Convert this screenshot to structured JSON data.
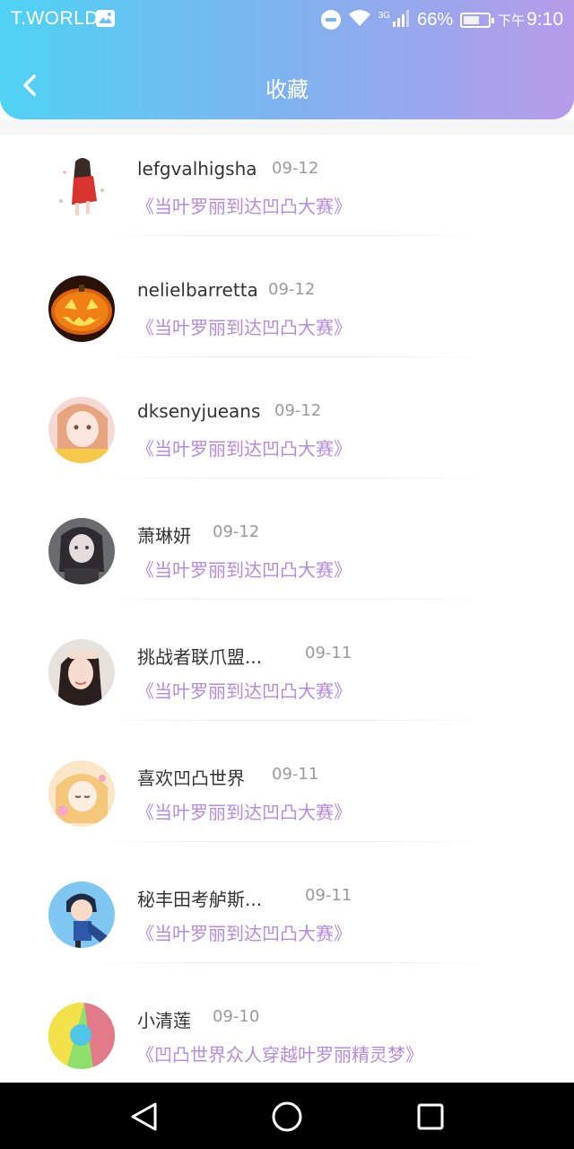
{
  "status_bar": {
    "carrier": "T.WORLD",
    "network": "3G",
    "battery": "66%",
    "battery_level": 0.66,
    "time_prefix": "下午",
    "time": "9:10"
  },
  "header": {
    "title": "收藏",
    "back_icon": "chevron-left-icon"
  },
  "colors": {
    "gradient_start": "#4fd3f5",
    "gradient_end": "#b79be9",
    "work_title": "#b58ae0",
    "username": "#333333",
    "date": "#9a9a9a"
  },
  "favorites": [
    {
      "name": "lefgvalhigsha",
      "date": "09-12",
      "work": "《当叶罗丽到达凹凸大赛》",
      "avatar": "avatar-girl-red-dress"
    },
    {
      "name": "nelielbarretta",
      "date": "09-12",
      "work": "《当叶罗丽到达凹凸大赛》",
      "avatar": "avatar-pumpkin"
    },
    {
      "name": "dksenyjueans",
      "date": "09-12",
      "work": "《当叶罗丽到达凹凸大赛》",
      "avatar": "avatar-anime-girl-pink"
    },
    {
      "name": "萧琳妍",
      "date": "09-12",
      "work": "《当叶罗丽到达凹凸大赛》",
      "avatar": "avatar-dark-girl"
    },
    {
      "name": "挑战者联爪盟...",
      "date": "09-11",
      "work": "《当叶罗丽到达凹凸大赛》",
      "avatar": "avatar-photo-girl"
    },
    {
      "name": "喜欢凹凸世界",
      "date": "09-11",
      "work": "《当叶罗丽到达凹凸大赛》",
      "avatar": "avatar-anime-blonde"
    },
    {
      "name": "秘丰田考舻斯...",
      "date": "09-11",
      "work": "《当叶罗丽到达凹凸大赛》",
      "avatar": "avatar-detective"
    },
    {
      "name": "小清莲",
      "date": "09-10",
      "work": "《凹凸世界众人穿越叶罗丽精灵梦》",
      "avatar": "avatar-colorful"
    }
  ],
  "system_nav": {
    "back": "back-triangle-icon",
    "home": "home-circle-icon",
    "recents": "recents-square-icon"
  }
}
